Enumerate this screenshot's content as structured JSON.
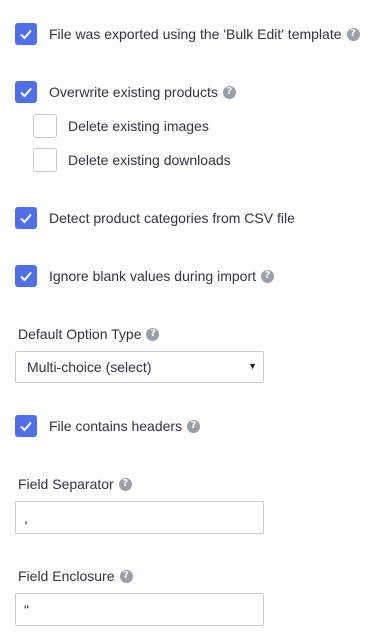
{
  "options": {
    "bulk_edit": {
      "label": "File was exported using the 'Bulk Edit' template",
      "checked": true
    },
    "overwrite": {
      "label": "Overwrite existing products",
      "checked": true
    },
    "delete_images": {
      "label": "Delete existing images",
      "checked": false
    },
    "delete_downloads": {
      "label": "Delete existing downloads",
      "checked": false
    },
    "detect_categories": {
      "label": "Detect product categories from CSV file",
      "checked": true
    },
    "ignore_blank": {
      "label": "Ignore blank values during import",
      "checked": true
    },
    "headers": {
      "label": "File contains headers",
      "checked": true
    }
  },
  "default_option_type": {
    "label": "Default Option Type",
    "selected": "Multi-choice (select)",
    "caret": "▼"
  },
  "field_separator": {
    "label": "Field Separator",
    "value": ","
  },
  "field_enclosure": {
    "label": "Field Enclosure",
    "value": "\""
  },
  "help_glyph": "?",
  "icons": {
    "check": "check-icon",
    "help": "help-icon",
    "dropdown": "chevron-down-icon"
  },
  "colors": {
    "accent": "#4f6fe8",
    "help": "#9aa0a8",
    "border": "#c9ccd2"
  }
}
